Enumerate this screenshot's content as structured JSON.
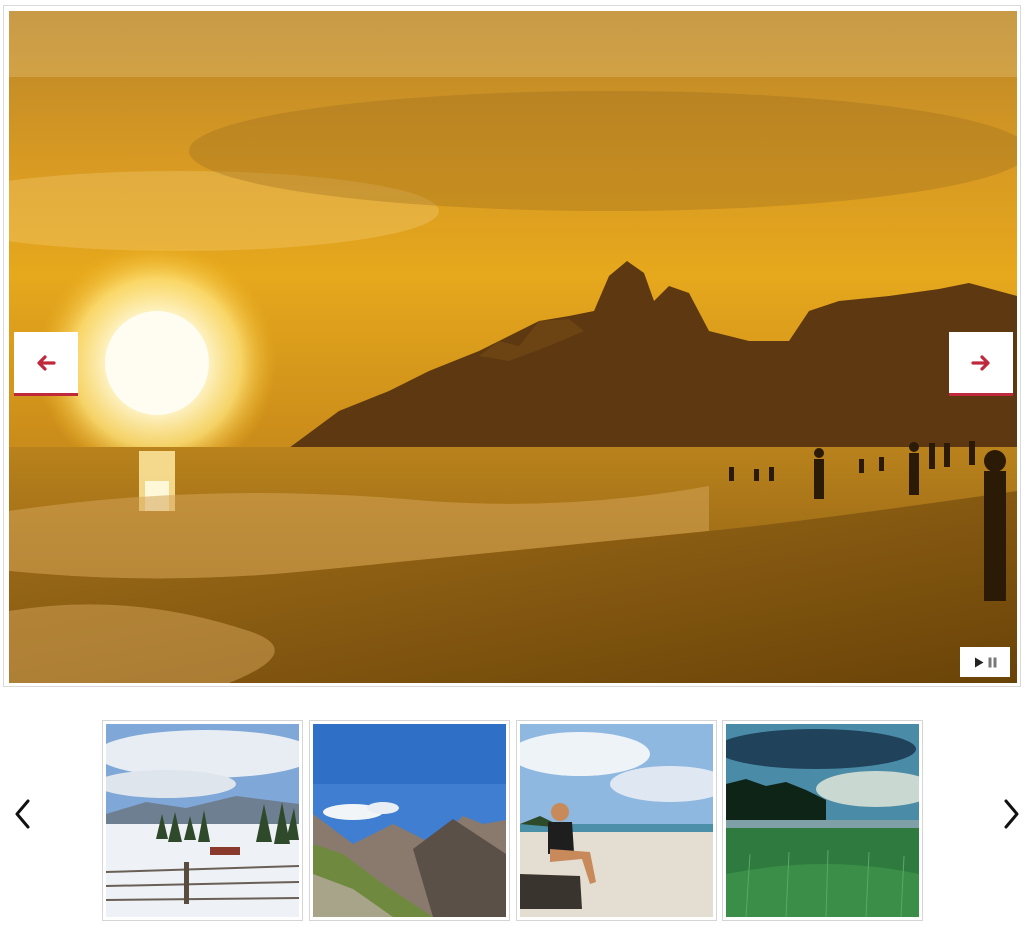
{
  "slideshow": {
    "current_image": "beach-sunset-mountains",
    "caption": "",
    "prev_icon": "arrow-left-icon",
    "next_icon": "arrow-right-icon",
    "accent_color": "#c0283c",
    "playback": {
      "play_icon": "play-icon",
      "pause_icon": "pause-icon"
    }
  },
  "thumbnails": {
    "prev_icon": "chevron-left-icon",
    "next_icon": "chevron-right-icon",
    "items": [
      {
        "name": "snowy-field-fence"
      },
      {
        "name": "mountain-valley-blue-sky"
      },
      {
        "name": "woman-sitting-on-beach"
      },
      {
        "name": "green-meadow-trees"
      }
    ]
  }
}
